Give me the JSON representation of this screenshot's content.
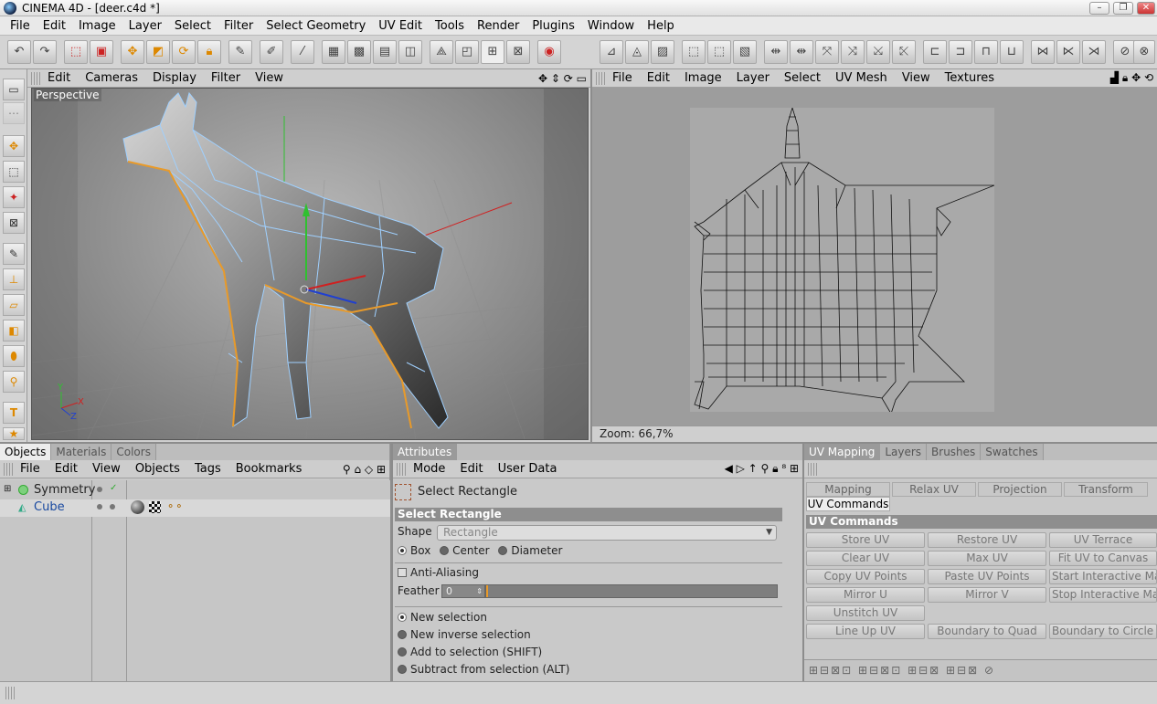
{
  "window": {
    "title": "CINEMA 4D - [deer.c4d *]"
  },
  "menubar": [
    "File",
    "Edit",
    "Image",
    "Layer",
    "Select",
    "Filter",
    "Select Geometry",
    "UV Edit",
    "Tools",
    "Render",
    "Plugins",
    "Window",
    "Help"
  ],
  "viewport": {
    "menu": [
      "Edit",
      "Cameras",
      "Display",
      "Filter",
      "View"
    ],
    "label": "Perspective"
  },
  "uv_editor": {
    "menu": [
      "File",
      "Edit",
      "Image",
      "Layer",
      "Select",
      "UV Mesh",
      "View",
      "Textures"
    ],
    "zoom": "Zoom: 66,7%"
  },
  "objects_panel": {
    "tabs": [
      "Objects",
      "Materials",
      "Colors"
    ],
    "menu": [
      "File",
      "Edit",
      "View",
      "Objects",
      "Tags",
      "Bookmarks"
    ],
    "items": [
      {
        "name": "Symmetry"
      },
      {
        "name": "Cube"
      }
    ]
  },
  "attributes_panel": {
    "tab": "Attributes",
    "menu": [
      "Mode",
      "Edit",
      "User Data"
    ],
    "tool_name": "Select Rectangle",
    "section": "Select Rectangle",
    "shape_label": "Shape",
    "shape_value": "Rectangle",
    "shape_options": [
      "Box",
      "Center",
      "Diameter"
    ],
    "anti_aliasing": "Anti-Aliasing",
    "feather_label": "Feather",
    "feather_value": "0",
    "selection_modes": [
      "New selection",
      "New inverse selection",
      "Add to selection (SHIFT)",
      "Subtract from selection (ALT)"
    ]
  },
  "uv_mapping_panel": {
    "tabs": [
      "UV Mapping",
      "Layers",
      "Brushes",
      "Swatches"
    ],
    "subtabs": [
      "Mapping",
      "Relax UV",
      "Projection",
      "Transform"
    ],
    "active_subtab": "UV Commands",
    "section": "UV Commands",
    "buttons": [
      [
        "Store UV",
        "Restore UV",
        "UV Terrace"
      ],
      [
        "Clear UV",
        "Max UV",
        "Fit UV to Canvas"
      ],
      [
        "Copy UV Points",
        "Paste UV Points",
        "Start Interactive Map"
      ],
      [
        "Mirror U",
        "Mirror V",
        "Stop Interactive Map"
      ],
      [
        "Unstitch UV"
      ],
      [
        "Line Up UV",
        "Boundary to Quad",
        "Boundary to Circle"
      ]
    ]
  },
  "colors": {
    "selection_orange": "#e89a2a",
    "wire_blue": "#9fd0ff",
    "axis_x": "#d02020",
    "axis_y": "#30c030",
    "axis_z": "#2040d0"
  }
}
